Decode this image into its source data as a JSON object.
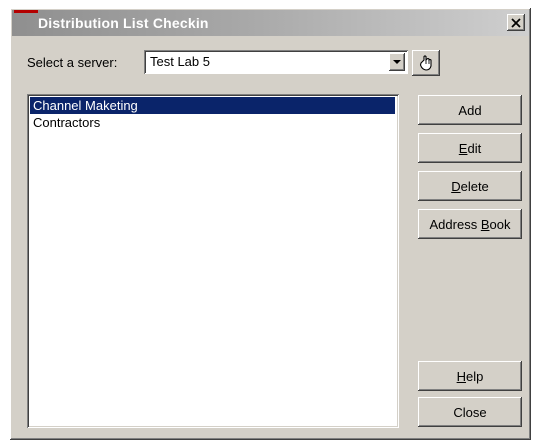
{
  "window": {
    "title": "Distribution List Checkin"
  },
  "server": {
    "label": "Select a server:",
    "value": "Test Lab 5"
  },
  "list": {
    "items": [
      {
        "label": "Channel Maketing",
        "selected": true
      },
      {
        "label": "Contractors",
        "selected": false
      }
    ]
  },
  "buttons": {
    "add": {
      "label": "Add"
    },
    "edit": {
      "pre": "",
      "accel": "E",
      "post": "dit"
    },
    "delete": {
      "pre": "",
      "accel": "D",
      "post": "elete"
    },
    "address_book": {
      "pre": "Address ",
      "accel": "B",
      "post": "ook"
    },
    "help": {
      "pre": "",
      "accel": "H",
      "post": "elp"
    },
    "close": {
      "label": "Close"
    }
  },
  "icons": {
    "close": "close-icon",
    "dropdown": "chevron-down-icon",
    "tool": "hand-pointer-icon"
  },
  "colors": {
    "selection": "#0a246a",
    "title_accent": "#b40000",
    "dialog_bg": "#d4d0c8"
  }
}
